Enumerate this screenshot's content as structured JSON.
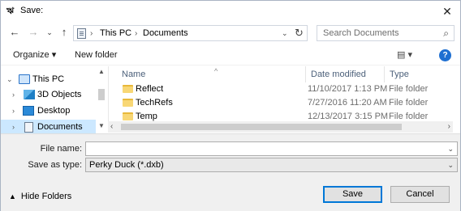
{
  "window": {
    "title": "Save:",
    "close_label": "✕"
  },
  "nav": {
    "back": "←",
    "forward": "→",
    "recent": "⌄",
    "up": "↑"
  },
  "address": {
    "crumbs": [
      "This PC",
      "Documents"
    ],
    "separator": "›",
    "dropdown": "⌄",
    "refresh": "↻"
  },
  "search": {
    "placeholder": "Search Documents",
    "icon": "⌕"
  },
  "toolbar": {
    "organize": "Organize ▾",
    "new_folder": "New folder",
    "view": "▤ ▾",
    "help": "?"
  },
  "sidebar": {
    "items": [
      {
        "label": "This PC",
        "chevron": "⌄",
        "icon": "pc-icon",
        "selected": false
      },
      {
        "label": "3D Objects",
        "chevron": "›",
        "icon": "3d-objects-icon",
        "selected": false
      },
      {
        "label": "Desktop",
        "chevron": "›",
        "icon": "desktop-icon",
        "selected": false
      },
      {
        "label": "Documents",
        "chevron": "›",
        "icon": "documents-icon",
        "selected": true
      }
    ]
  },
  "filelist": {
    "columns": [
      "Name",
      "Date modified",
      "Type"
    ],
    "rows": [
      {
        "name": "Reflect",
        "date": "11/10/2017 1:13 PM",
        "type": "File folder"
      },
      {
        "name": "TechRefs",
        "date": "7/27/2016 11:20 AM",
        "type": "File folder"
      },
      {
        "name": "Temp",
        "date": "12/13/2017 3:15 PM",
        "type": "File folder"
      }
    ]
  },
  "form": {
    "file_name_label": "File name:",
    "file_name_value": "",
    "save_type_label": "Save as type:",
    "save_type_value": "Perky Duck (*.dxb)"
  },
  "footer": {
    "hide_folders": "Hide Folders",
    "save": "Save",
    "cancel": "Cancel"
  }
}
